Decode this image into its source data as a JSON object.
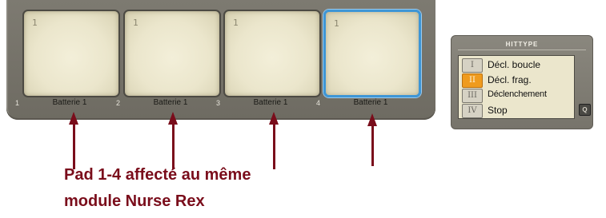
{
  "pads": [
    {
      "index": "1",
      "value": "1",
      "name": "Batterie 1",
      "selected": false
    },
    {
      "index": "2",
      "value": "1",
      "name": "Batterie 1",
      "selected": false
    },
    {
      "index": "3",
      "value": "1",
      "name": "Batterie 1",
      "selected": false
    },
    {
      "index": "4",
      "value": "1",
      "name": "Batterie 1",
      "selected": true
    }
  ],
  "hittype": {
    "title": "HITTYPE",
    "options": [
      {
        "roman": "I",
        "label": "Décl. boucle",
        "active": false
      },
      {
        "roman": "II",
        "label": "Décl. frag.",
        "active": true
      },
      {
        "roman": "III",
        "label": "Déclenchement",
        "active": false
      },
      {
        "roman": "IV",
        "label": "Stop",
        "active": false
      }
    ],
    "q_button_label": "Q"
  },
  "annotation": {
    "line1": "Pad 1-4 affecté au même",
    "line2": "module Nurse Rex"
  },
  "colors": {
    "accent_selected": "#3e96d6",
    "active_option": "#ef9b1e",
    "arrow": "#7a0d1b"
  }
}
